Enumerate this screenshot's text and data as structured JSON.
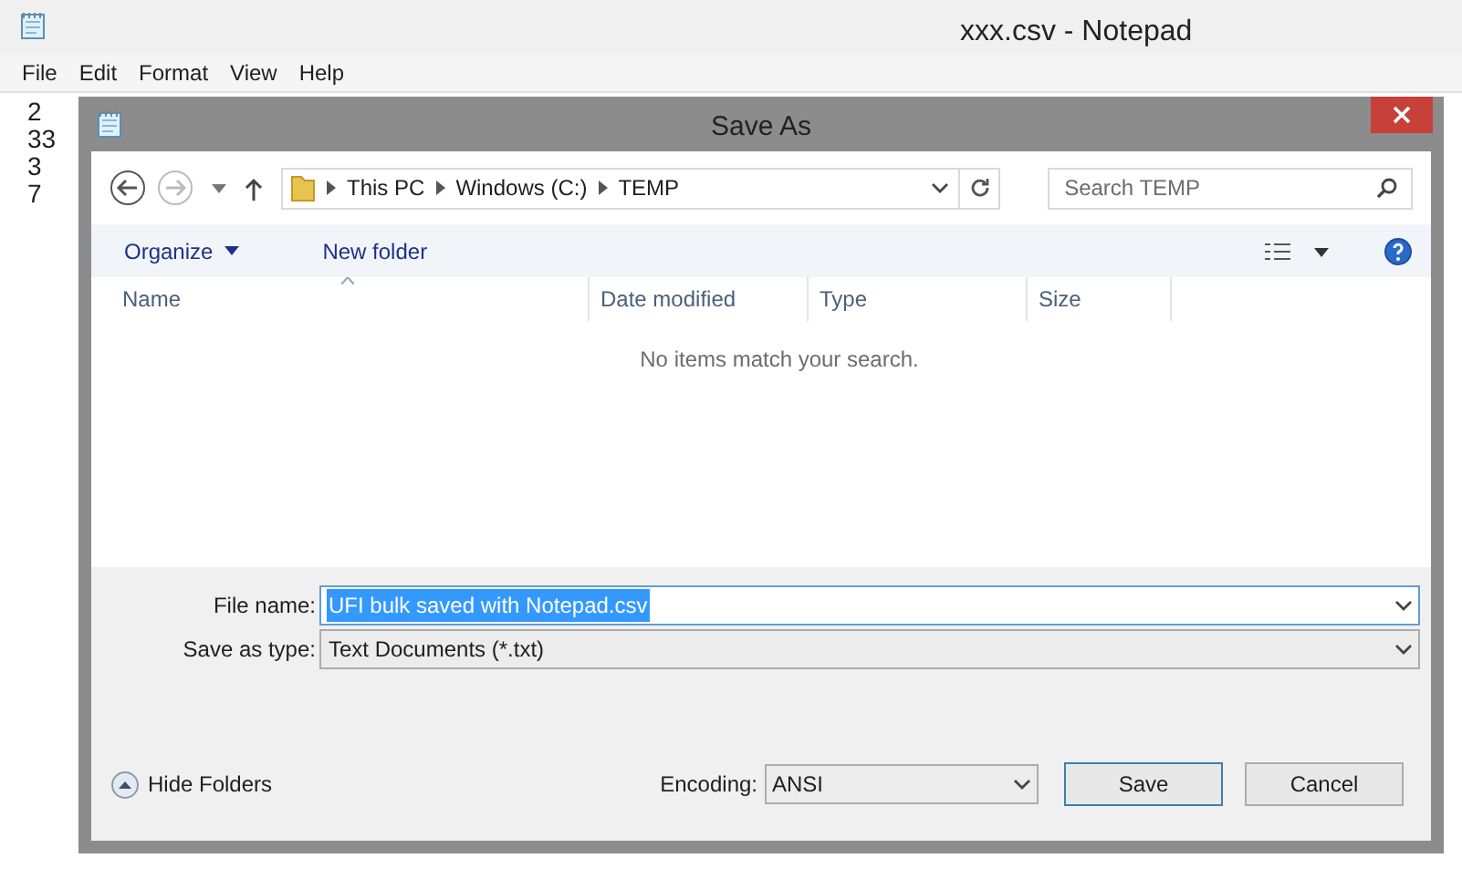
{
  "notepad": {
    "title": "xxx.csv - Notepad",
    "menu": [
      "File",
      "Edit",
      "Format",
      "View",
      "Help"
    ],
    "lines": [
      "2",
      "33",
      "3",
      "7"
    ]
  },
  "dialog": {
    "title": "Save As",
    "path": [
      "This PC",
      "Windows (C:)",
      "TEMP"
    ],
    "search": {
      "placeholder": "Search TEMP"
    },
    "toolbar": [
      {
        "label": "Organize",
        "kind": "menu"
      },
      {
        "label": "New folder",
        "kind": "button"
      }
    ],
    "columns": [
      "Name",
      "Date modified",
      "Type",
      "Size"
    ],
    "empty_message": "No items match your search.",
    "file_name": {
      "label": "File name:",
      "value": "UFI bulk saved with Notepad.csv",
      "selected": true
    },
    "save_as_type": {
      "label": "Save as type:",
      "value": "Text Documents (*.txt)"
    },
    "hide_folders": "Hide Folders",
    "encoding": {
      "label": "Encoding:",
      "value": "ANSI"
    },
    "buttons": [
      {
        "label": "Save",
        "default": true
      },
      {
        "label": "Cancel",
        "default": false
      }
    ]
  }
}
